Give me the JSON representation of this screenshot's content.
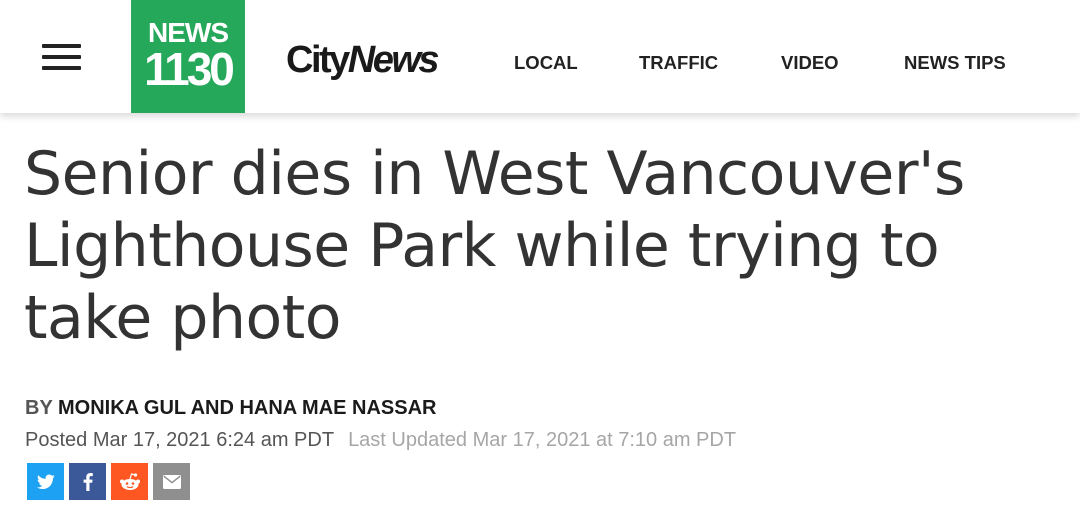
{
  "header": {
    "news_logo_line1": "NEWS",
    "news_logo_line2": "1130",
    "city_logo_city": "City",
    "city_logo_news": "News",
    "nav": [
      {
        "label": "LOCAL"
      },
      {
        "label": "TRAFFIC"
      },
      {
        "label": "VIDEO"
      },
      {
        "label": "NEWS TIPS"
      }
    ],
    "brand_color": "#26a85a"
  },
  "article": {
    "headline": "Senior dies in West Vancouver's Lighthouse Park while trying to take photo",
    "byline_prefix": "BY",
    "byline_authors": "MONIKA GUL AND HANA MAE NASSAR",
    "posted": "Posted Mar 17, 2021 6:24 am PDT",
    "last_updated": "Last Updated Mar 17, 2021 at 7:10 am PDT"
  },
  "share": [
    {
      "icon": "twitter-icon",
      "color": "#1da1f2"
    },
    {
      "icon": "facebook-icon",
      "color": "#3b5998"
    },
    {
      "icon": "reddit-icon",
      "color": "#ff5722"
    },
    {
      "icon": "email-icon",
      "color": "#8f8f8f"
    }
  ]
}
